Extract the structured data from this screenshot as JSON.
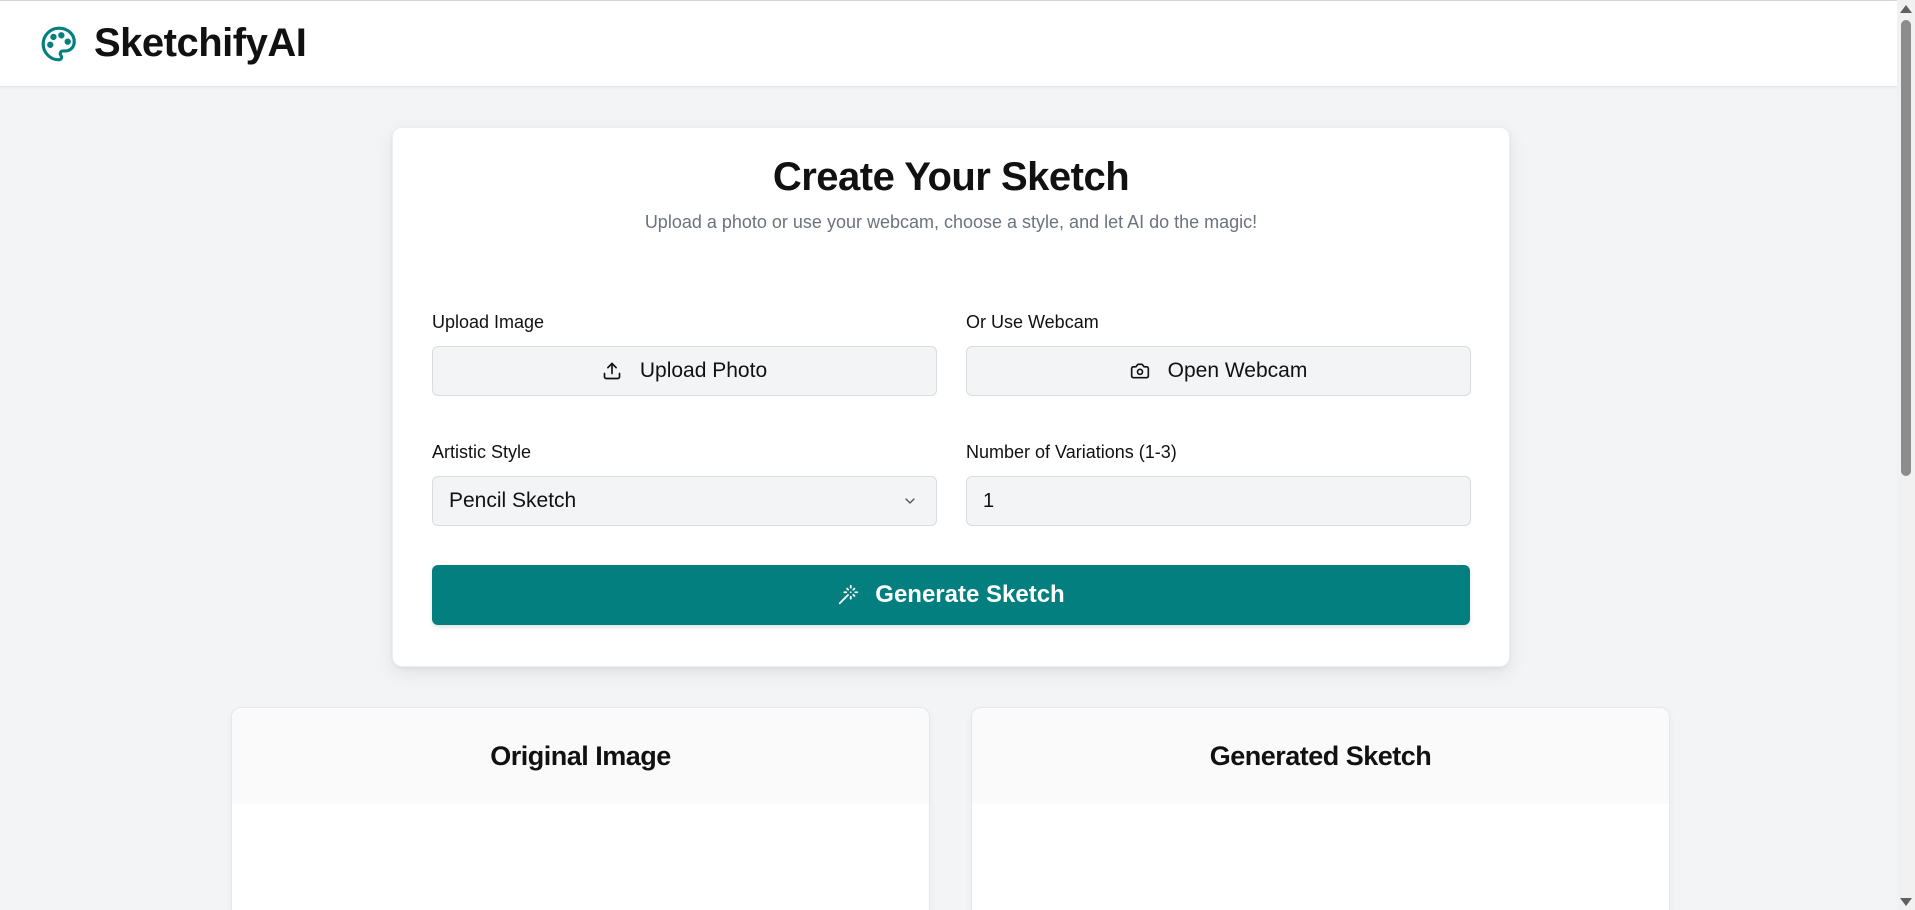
{
  "app": {
    "name": "SketchifyAI",
    "logo_icon": "palette-icon",
    "accent_color": "#047f7f"
  },
  "form": {
    "title": "Create Your Sketch",
    "subtitle": "Upload a photo or use your webcam, choose a style, and let AI do the magic!",
    "upload": {
      "label": "Upload Image",
      "button_label": "Upload Photo",
      "icon": "upload-icon"
    },
    "webcam": {
      "label": "Or Use Webcam",
      "button_label": "Open Webcam",
      "icon": "camera-icon"
    },
    "style": {
      "label": "Artistic Style",
      "selected": "Pencil Sketch",
      "icon": "chevron-down-icon"
    },
    "variations": {
      "label": "Number of Variations (1-3)",
      "value": "1"
    },
    "generate": {
      "label": "Generate Sketch",
      "icon": "magic-wand-icon"
    }
  },
  "results": {
    "original_title": "Original Image",
    "generated_title": "Generated Sketch"
  }
}
